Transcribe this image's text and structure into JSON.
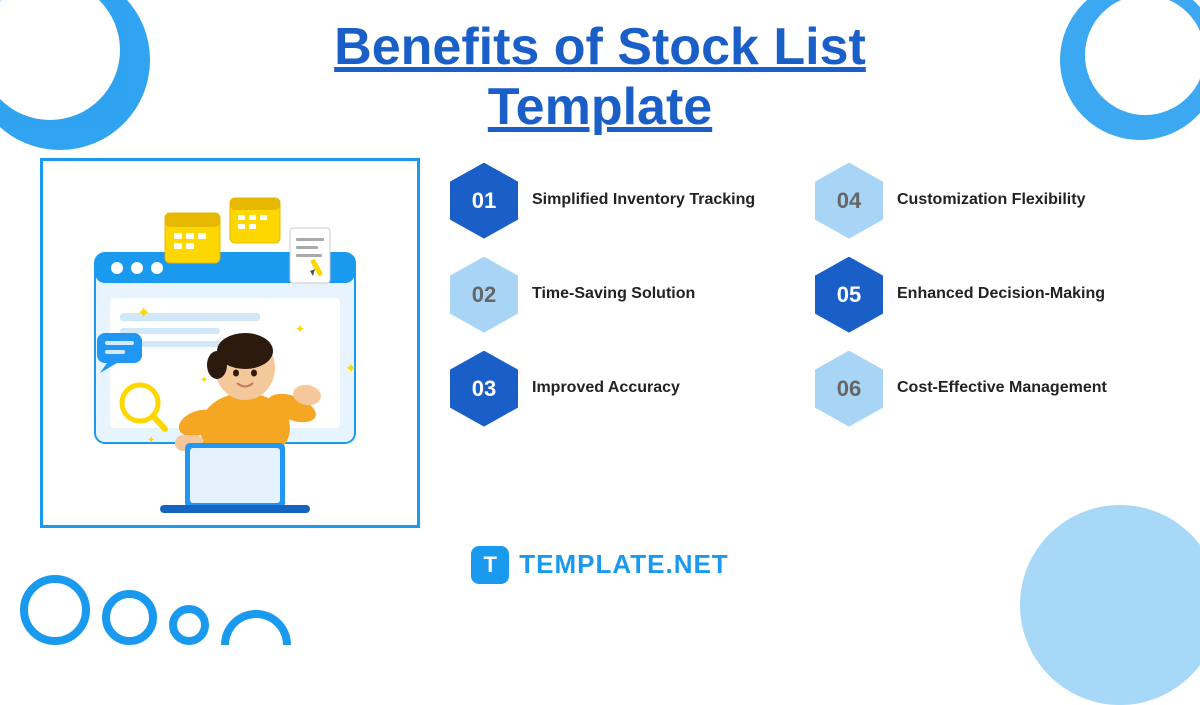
{
  "header": {
    "line1": "Benefits of Stock List",
    "line2": "Template"
  },
  "benefits": [
    {
      "id": "01",
      "label": "Simplified Inventory Tracking",
      "style": "dark-blue"
    },
    {
      "id": "04",
      "label": "Customization Flexibility",
      "style": "light-blue"
    },
    {
      "id": "02",
      "label": "Time-Saving Solution",
      "style": "light-blue"
    },
    {
      "id": "05",
      "label": "Enhanced Decision-Making",
      "style": "dark-blue"
    },
    {
      "id": "03",
      "label": "Improved Accuracy",
      "style": "dark-blue"
    },
    {
      "id": "06",
      "label": "Cost-Effective Management",
      "style": "light-blue"
    }
  ],
  "footer": {
    "logo_letter": "T",
    "logo_brand": "TEMPLATE",
    "logo_suffix": ".NET"
  },
  "decorative": {
    "colors": {
      "primary": "#1a9aef",
      "dark_blue": "#1a5fc8",
      "light_blue": "#a8d5f5"
    }
  }
}
